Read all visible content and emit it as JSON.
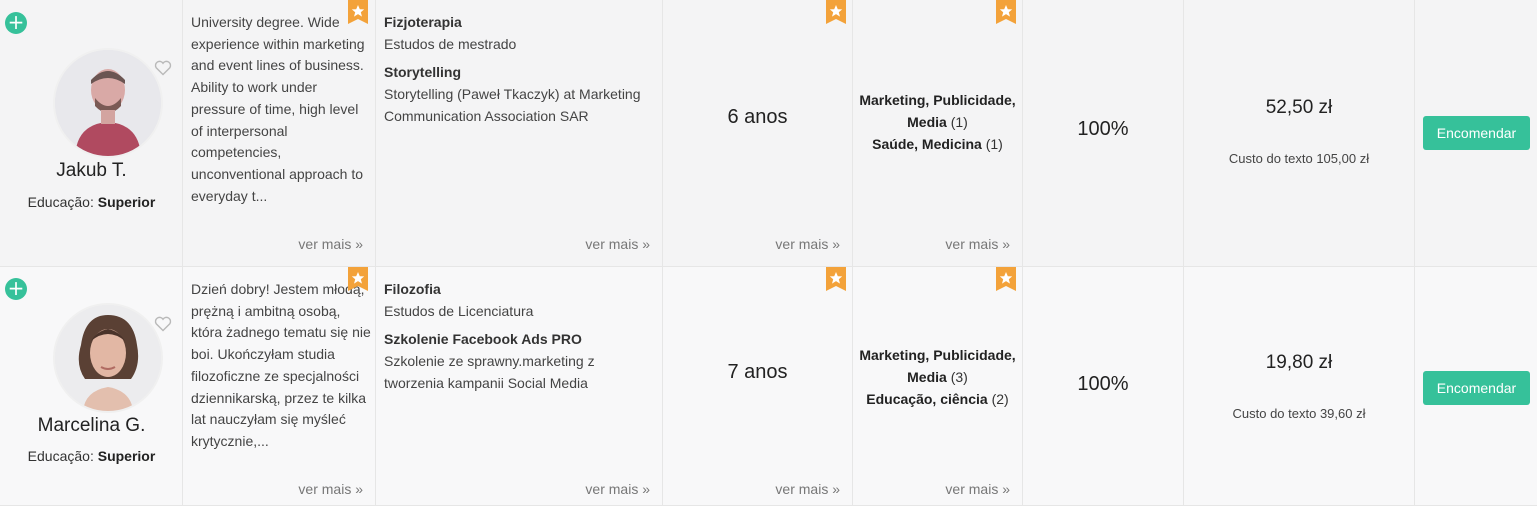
{
  "colors": {
    "accent": "#36c19a",
    "badge": "#f3a23a",
    "row_bg_1": "#f4f4f5",
    "row_bg_2": "#f8f8f9"
  },
  "translators": [
    {
      "name": "Jakub T.",
      "education_label": "Educação:",
      "education_value": "Superior",
      "description": "University degree. Wide experience within marketing and event lines of business. Ability to work under pressure of time, high level of interpersonal competencies, unconventional approach to everyday t...",
      "education_items": [
        {
          "title": "Fizjoterapia",
          "detail": "Estudos de mestrado"
        },
        {
          "title": "Storytelling",
          "detail": "Storytelling (Paweł Tkaczyk) at Marketing Communication Association SAR"
        }
      ],
      "experience": "6 anos",
      "specializations": [
        {
          "label": "Marketing, Publicidade, Media",
          "count": "(1)"
        },
        {
          "label": "Saúde, Medicina",
          "count": "(1)"
        }
      ],
      "percentage": "100%",
      "price": "52,50 zł",
      "cost_text": "Custo do texto 105,00 zł",
      "order_label": "Encomendar"
    },
    {
      "name": "Marcelina G.",
      "education_label": "Educação:",
      "education_value": "Superior",
      "description": "Dzień dobry!  Jestem młodą, prężną i ambitną osobą, która żadnego tematu się nie boi. Ukończyłam studia filozoficzne ze specjalności dziennikarską, przez te kilka lat nauczyłam się myśleć krytycznie,...",
      "education_items": [
        {
          "title": "Filozofia",
          "detail": "Estudos de Licenciatura"
        },
        {
          "title": "Szkolenie Facebook Ads PRO",
          "detail": "Szkolenie ze sprawny.marketing z tworzenia kampanii Social Media"
        }
      ],
      "experience": "7 anos",
      "specializations": [
        {
          "label": "Marketing, Publicidade, Media",
          "count": "(3)"
        },
        {
          "label": "Educação, ciência",
          "count": "(2)"
        }
      ],
      "percentage": "100%",
      "price": "19,80 zł",
      "cost_text": "Custo do texto 39,60 zł",
      "order_label": "Encomendar"
    }
  ],
  "see_more_label": "ver mais »",
  "icons": {
    "add": "plus-circle-icon",
    "favorite": "heart-outline-icon",
    "badge": "star-bookmark-icon"
  }
}
